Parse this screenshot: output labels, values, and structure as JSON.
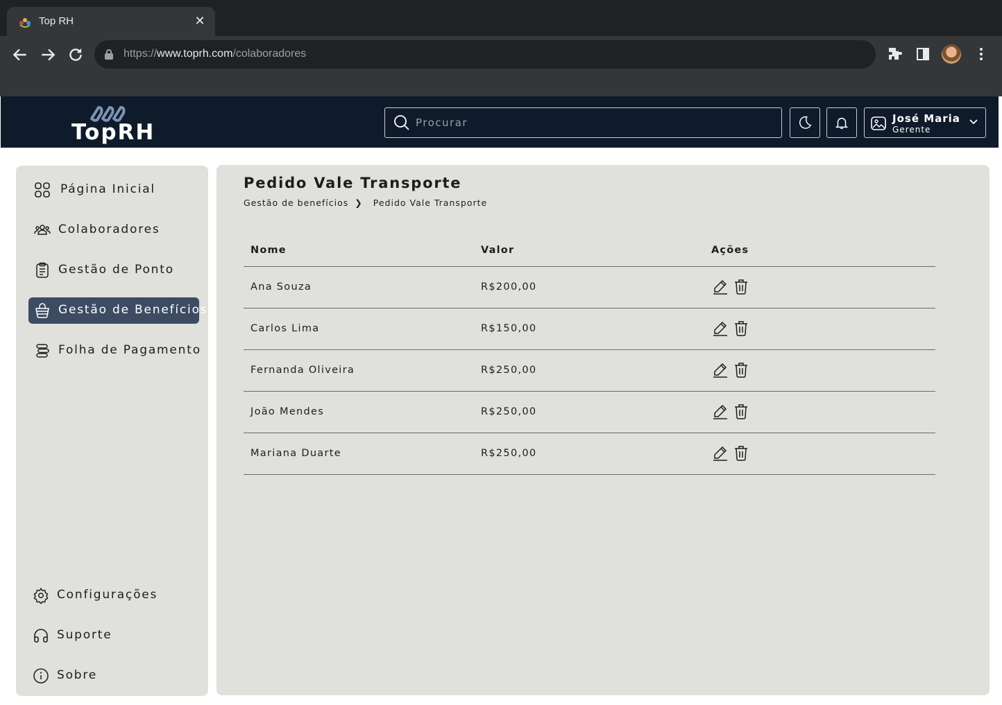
{
  "browser": {
    "tab_title": "Top RH",
    "url_scheme": "https://",
    "url_host": "www.toprh.com",
    "url_path": "/colaboradores"
  },
  "header": {
    "logo_text": "TopRH",
    "search_placeholder": "Procurar",
    "user_name": "José Maria",
    "user_role": "Gerente"
  },
  "sidebar": {
    "items": [
      {
        "label": "Página Inicial",
        "icon": "grid-icon"
      },
      {
        "label": "Colaboradores",
        "icon": "people-icon"
      },
      {
        "label": "Gestão de Ponto",
        "icon": "clipboard-icon"
      },
      {
        "label": "Gestão de Benefícios",
        "icon": "basket-icon",
        "active": true
      },
      {
        "label": "Folha de Pagamento",
        "icon": "coins-icon"
      }
    ],
    "bottom_items": [
      {
        "label": "Configurações",
        "icon": "gear-icon"
      },
      {
        "label": "Suporte",
        "icon": "headset-icon"
      },
      {
        "label": "Sobre",
        "icon": "info-icon"
      }
    ],
    "active_color": "#3d4b63"
  },
  "main": {
    "title": "Pedido Vale Transporte",
    "breadcrumb": {
      "parent": "Gestão de benefícios",
      "separator": "❯",
      "current": "Pedido Vale Transporte"
    },
    "table": {
      "columns": [
        "Nome",
        "Valor",
        "Ações"
      ],
      "rows": [
        {
          "nome": "Ana Souza",
          "valor": "R$200,00"
        },
        {
          "nome": "Carlos Lima",
          "valor": "R$150,00"
        },
        {
          "nome": "Fernanda Oliveira",
          "valor": "R$250,00"
        },
        {
          "nome": "João Mendes",
          "valor": "R$250,00"
        },
        {
          "nome": "Mariana Duarte",
          "valor": "R$250,00"
        }
      ]
    }
  }
}
